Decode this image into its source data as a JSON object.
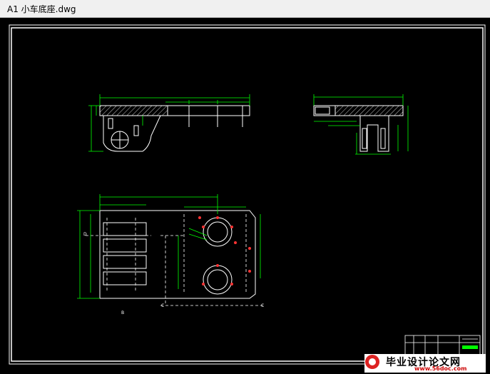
{
  "window": {
    "title": "A1 小车底座.dwg"
  },
  "watermark": {
    "text": "毕业设计论文网",
    "site": "www.56doc.com"
  },
  "colors": {
    "outline": "#ffffff",
    "dimension": "#00ff00",
    "hatch": "#ffffff",
    "center_mark": "#ff0000"
  }
}
